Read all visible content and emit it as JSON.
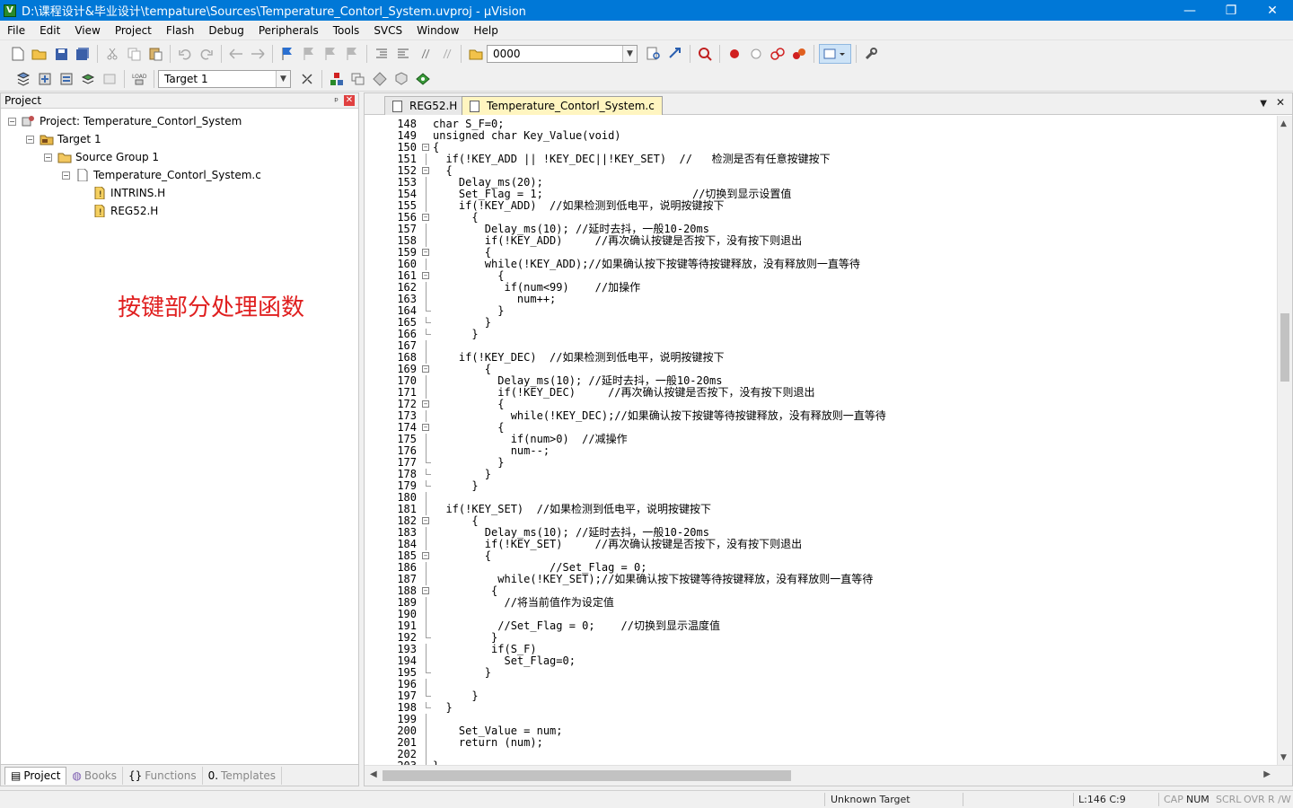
{
  "window": {
    "title": "D:\\课程设计&毕业设计\\tempature\\Sources\\Temperature_Contorl_System.uvproj - µVision",
    "controls": [
      "—",
      "❐",
      "✕"
    ]
  },
  "menu": [
    "File",
    "Edit",
    "View",
    "Project",
    "Flash",
    "Debug",
    "Peripherals",
    "Tools",
    "SVCS",
    "Window",
    "Help"
  ],
  "toolbar": {
    "find_value": "0000",
    "target_value": "Target 1",
    "load_label": "LOAD"
  },
  "project_panel": {
    "title": "Project",
    "pin": "ᵖ",
    "close": "✕",
    "tree": [
      {
        "label": "Project: Temperature_Contorl_System",
        "depth": 0,
        "exp": "−"
      },
      {
        "label": "Target 1",
        "depth": 1,
        "exp": "−"
      },
      {
        "label": "Source Group 1",
        "depth": 2,
        "exp": "−"
      },
      {
        "label": "Temperature_Contorl_System.c",
        "depth": 3,
        "exp": "−"
      },
      {
        "label": "INTRINS.H",
        "depth": 4,
        "exp": ""
      },
      {
        "label": "REG52.H",
        "depth": 4,
        "exp": ""
      }
    ],
    "annotation": "按键部分处理函数",
    "tabs": [
      {
        "label": "Project",
        "active": true
      },
      {
        "label": "Books",
        "active": false
      },
      {
        "label": "Functions",
        "active": false
      },
      {
        "label": "Templates",
        "active": false
      }
    ]
  },
  "editor": {
    "tabs": [
      {
        "label": "REG52.H",
        "active": false
      },
      {
        "label": "Temperature_Contorl_System.c",
        "active": true
      }
    ],
    "menu_arrow": "▼",
    "close": "✕",
    "lines": [
      {
        "n": "148",
        "t": "char S_F=0;",
        "f": ""
      },
      {
        "n": "149",
        "t": "unsigned char Key_Value(void)",
        "f": ""
      },
      {
        "n": "150",
        "t": "{",
        "f": "open"
      },
      {
        "n": "151",
        "t": "  if(!KEY_ADD || !KEY_DEC||!KEY_SET)  //   检测是否有任意按键按下",
        "f": "line"
      },
      {
        "n": "152",
        "t": "  {",
        "f": "open"
      },
      {
        "n": "153",
        "t": "    Delay_ms(20);",
        "f": "line"
      },
      {
        "n": "154",
        "t": "    Set_Flag = 1;                       //切换到显示设置值",
        "f": "line"
      },
      {
        "n": "155",
        "t": "    if(!KEY_ADD)  //如果检测到低电平，说明按键按下",
        "f": "line"
      },
      {
        "n": "156",
        "t": "      {",
        "f": "open"
      },
      {
        "n": "157",
        "t": "        Delay_ms(10); //延时去抖，一般10-20ms",
        "f": "line"
      },
      {
        "n": "158",
        "t": "        if(!KEY_ADD)     //再次确认按键是否按下，没有按下则退出",
        "f": "line"
      },
      {
        "n": "159",
        "t": "        {",
        "f": "open"
      },
      {
        "n": "160",
        "t": "        while(!KEY_ADD);//如果确认按下按键等待按键释放，没有释放则一直等待",
        "f": "line"
      },
      {
        "n": "161",
        "t": "          {",
        "f": "open"
      },
      {
        "n": "162",
        "t": "           if(num<99)    //加操作",
        "f": "line"
      },
      {
        "n": "163",
        "t": "             num++;",
        "f": "line"
      },
      {
        "n": "164",
        "t": "          }",
        "f": "end"
      },
      {
        "n": "165",
        "t": "        }",
        "f": "end"
      },
      {
        "n": "166",
        "t": "      }",
        "f": "end"
      },
      {
        "n": "167",
        "t": "",
        "f": "line"
      },
      {
        "n": "168",
        "t": "    if(!KEY_DEC)  //如果检测到低电平，说明按键按下",
        "f": "line"
      },
      {
        "n": "169",
        "t": "        {",
        "f": "open"
      },
      {
        "n": "170",
        "t": "          Delay_ms(10); //延时去抖，一般10-20ms",
        "f": "line"
      },
      {
        "n": "171",
        "t": "          if(!KEY_DEC)     //再次确认按键是否按下，没有按下则退出",
        "f": "line"
      },
      {
        "n": "172",
        "t": "          {",
        "f": "open"
      },
      {
        "n": "173",
        "t": "            while(!KEY_DEC);//如果确认按下按键等待按键释放，没有释放则一直等待",
        "f": "line"
      },
      {
        "n": "174",
        "t": "          {",
        "f": "open"
      },
      {
        "n": "175",
        "t": "            if(num>0)  //减操作",
        "f": "line"
      },
      {
        "n": "176",
        "t": "            num--;",
        "f": "line"
      },
      {
        "n": "177",
        "t": "          }",
        "f": "end"
      },
      {
        "n": "178",
        "t": "        }",
        "f": "end"
      },
      {
        "n": "179",
        "t": "      }",
        "f": "end"
      },
      {
        "n": "180",
        "t": "",
        "f": "line"
      },
      {
        "n": "181",
        "t": "  if(!KEY_SET)  //如果检测到低电平，说明按键按下",
        "f": "line"
      },
      {
        "n": "182",
        "t": "      {",
        "f": "open"
      },
      {
        "n": "183",
        "t": "        Delay_ms(10); //延时去抖，一般10-20ms",
        "f": "line"
      },
      {
        "n": "184",
        "t": "        if(!KEY_SET)     //再次确认按键是否按下，没有按下则退出",
        "f": "line"
      },
      {
        "n": "185",
        "t": "        {",
        "f": "open"
      },
      {
        "n": "186",
        "t": "                  //Set_Flag = 0;",
        "f": "line"
      },
      {
        "n": "187",
        "t": "          while(!KEY_SET);//如果确认按下按键等待按键释放，没有释放则一直等待",
        "f": "line"
      },
      {
        "n": "188",
        "t": "         {",
        "f": "open"
      },
      {
        "n": "189",
        "t": "           //将当前值作为设定值",
        "f": "line"
      },
      {
        "n": "190",
        "t": "",
        "f": "line"
      },
      {
        "n": "191",
        "t": "          //Set_Flag = 0;    //切换到显示温度值",
        "f": "line"
      },
      {
        "n": "192",
        "t": "         }",
        "f": "end"
      },
      {
        "n": "193",
        "t": "         if(S_F)",
        "f": "line"
      },
      {
        "n": "194",
        "t": "           Set_Flag=0;",
        "f": "line"
      },
      {
        "n": "195",
        "t": "        }",
        "f": "end"
      },
      {
        "n": "196",
        "t": "",
        "f": "line"
      },
      {
        "n": "197",
        "t": "      }",
        "f": "end"
      },
      {
        "n": "198",
        "t": "  }",
        "f": "end"
      },
      {
        "n": "199",
        "t": "",
        "f": "line"
      },
      {
        "n": "200",
        "t": "    Set_Value = num;",
        "f": "line"
      },
      {
        "n": "201",
        "t": "    return (num);",
        "f": "line"
      },
      {
        "n": "202",
        "t": "",
        "f": "line"
      },
      {
        "n": "203",
        "t": "}",
        "f": "end"
      }
    ]
  },
  "status": {
    "target": "Unknown Target",
    "position": "L:146 C:9",
    "cap": "CAP",
    "num": "NUM",
    "scrl": "SCRL",
    "ovr": "OVR",
    "rw": "R /W"
  },
  "colors": {
    "titlebar": "#0078d7",
    "annotation": "#e02020",
    "active_tab": "#fff5c0"
  }
}
